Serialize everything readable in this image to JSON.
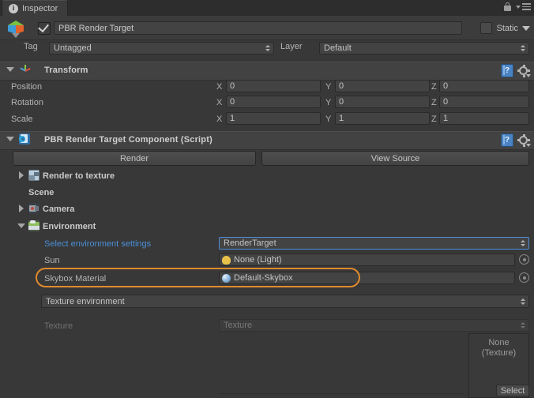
{
  "window": {
    "tab_label": "Inspector",
    "tab_icon": "info-icon",
    "lock_icon": "lock-icon",
    "menu_icon": "menu-icon"
  },
  "object_header": {
    "icon": "gameobject-cube-icon",
    "enabled": true,
    "name": "PBR Render Target",
    "static_label": "Static",
    "static_checked": false
  },
  "tag_layer": {
    "tag_label": "Tag",
    "tag_value": "Untagged",
    "layer_label": "Layer",
    "layer_value": "Default"
  },
  "transform": {
    "title": "Transform",
    "icon": "transform-axis-icon",
    "expanded": true,
    "help_icon": "help-book-icon",
    "gear_icon": "gear-icon",
    "rows": [
      {
        "label": "Position",
        "x": "0",
        "y": "0",
        "z": "0"
      },
      {
        "label": "Rotation",
        "x": "0",
        "y": "0",
        "z": "0"
      },
      {
        "label": "Scale",
        "x": "1",
        "y": "1",
        "z": "1"
      }
    ],
    "axis_labels": {
      "x": "X",
      "y": "Y",
      "z": "Z"
    }
  },
  "component": {
    "title": "PBR Render Target Component (Script)",
    "icon": "cs-script-icon",
    "expanded": true,
    "help_icon": "help-book-icon",
    "gear_icon": "gear-icon",
    "buttons": [
      {
        "label": "Render"
      },
      {
        "label": "View Source"
      }
    ],
    "tree": [
      {
        "label": "Render to texture",
        "foldout": "right",
        "icon": "render-texture-icon",
        "indent": 0
      },
      {
        "label": "Scene",
        "foldout": "none",
        "icon": "none",
        "indent": 1
      },
      {
        "label": "Camera",
        "foldout": "right",
        "icon": "camera-icon",
        "indent": 0
      },
      {
        "label": "Environment",
        "foldout": "down",
        "icon": "environment-icon",
        "indent": 0
      }
    ],
    "environment": {
      "select_settings": {
        "label": "Select environment settings",
        "value": "RenderTarget",
        "label_is_link": true,
        "highlighted": true
      },
      "sun": {
        "label": "Sun",
        "value": "None (Light)",
        "icon": "light-bulb-icon",
        "picker_icon": "object-picker-icon"
      },
      "skybox": {
        "label": "Skybox Material",
        "value": "Default-Skybox",
        "icon": "material-ball-icon",
        "picker_icon": "object-picker-icon",
        "annotated": true
      },
      "environment_mode": {
        "value": "Texture environment"
      },
      "texture": {
        "label": "Texture",
        "value": "Texture",
        "disabled": true
      },
      "preview": {
        "line1": "None",
        "line2": "(Texture)",
        "select_label": "Select"
      }
    }
  },
  "colors": {
    "background": "#383838",
    "panel": "#3c3c3c",
    "header": "#424242",
    "field": "#434343",
    "text": "#b4b4b4",
    "link": "#4b8fd6",
    "annotation": "#e08a2e"
  }
}
